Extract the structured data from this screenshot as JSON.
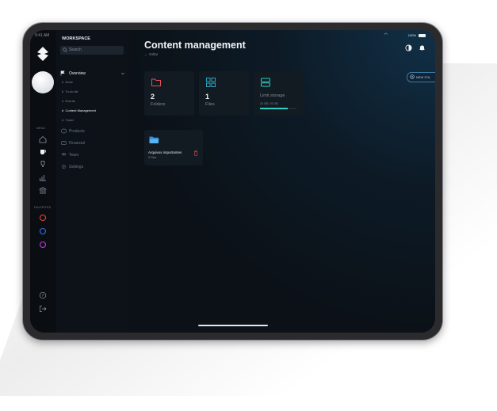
{
  "status_bar": {
    "time": "9:41 AM",
    "battery": "100%"
  },
  "sidebar": {
    "workspace_label": "WORKSPACE",
    "search_placeholder": "Search",
    "overview": "Overview",
    "overview_items": [
      "None",
      "To-do list",
      "Events",
      "Content Management",
      "Ticket"
    ],
    "active_item": "Content Management",
    "menu_items": [
      "Products",
      "Financial",
      "Team",
      "Settings"
    ]
  },
  "rail": {
    "menu_label": "MENU",
    "favorites_label": "FAVORITES",
    "favorite_colors": [
      "#e8433a",
      "#2f6fe0",
      "#c23ad6"
    ]
  },
  "main": {
    "title": "Content management",
    "back_label": "← Voltar",
    "new_folder_label": "NEW FOL",
    "cards": [
      {
        "value": "2",
        "label": "Folders",
        "icon": "folder-icon",
        "color": "#e2505a"
      },
      {
        "value": "1",
        "label": "Files",
        "icon": "grid-icon",
        "color": "#2fb6d2"
      },
      {
        "value": "",
        "label": "Limit storage",
        "icon": "server-icon",
        "color": "#2fcfc2",
        "caption": "15 GB / 20 GB",
        "progress": 0.75
      }
    ],
    "folder": {
      "name": "Arquivos importantes",
      "meta": "5 Files",
      "icon": "folder-open-icon",
      "color": "#2d8fd8"
    }
  }
}
